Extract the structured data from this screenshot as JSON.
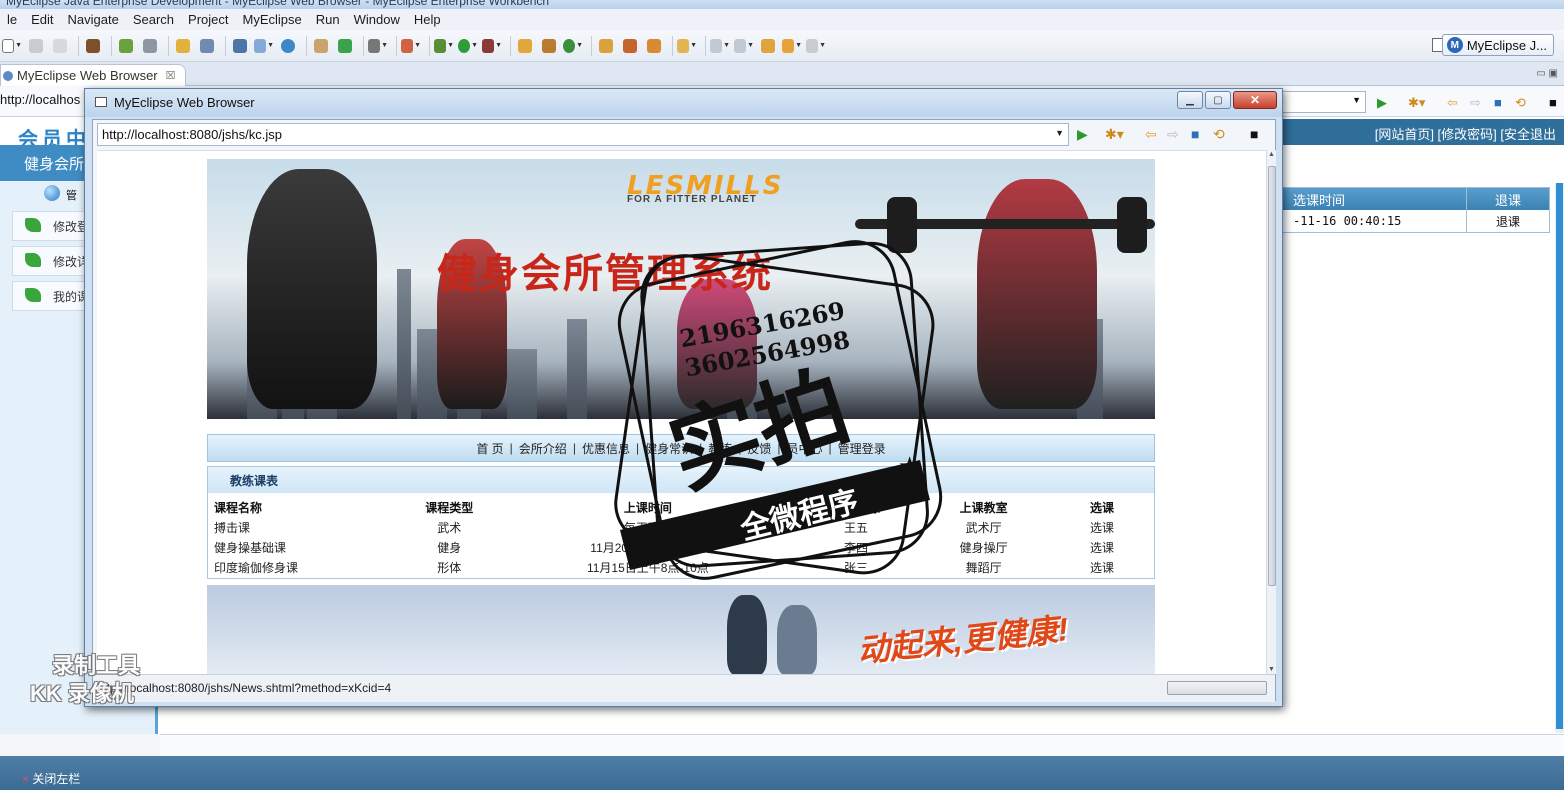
{
  "window": {
    "title": "MyEclipse Java Enterprise Development - MyEclipse Web Browser - MyEclipse Enterprise Workbench"
  },
  "menu": [
    "le",
    "Edit",
    "Navigate",
    "Search",
    "Project",
    "MyEclipse",
    "Run",
    "Window",
    "Help"
  ],
  "perspective": {
    "label": "MyEclipse J..."
  },
  "editor_tab": {
    "label": "MyEclipse Web Browser"
  },
  "bg_browser": {
    "url": "http://localhos"
  },
  "bg_page": {
    "logo": "会员中",
    "top_links": "[网站首页] [修改密码] [安全退出",
    "sidebar_title": "健身会所",
    "sidebar_items": [
      "管",
      "修改登",
      "修改详",
      "我的课"
    ],
    "table_headers": [
      "选课时间",
      "退课"
    ],
    "table_row": [
      "-11-16 00:40:15",
      "退课"
    ],
    "close_left": "关闭左栏"
  },
  "popup": {
    "title": "MyEclipse Web Browser",
    "url": "http://localhost:8080/jshs/kc.jsp",
    "status": "http://localhost:8080/jshs/News.shtml?method=xKcid=4"
  },
  "site": {
    "brand": "LESMILLS",
    "brand_sub": "FOR A FITTER PLANET",
    "title": "健身会所管理系统",
    "nav": [
      "首 页",
      "会所介绍",
      "优惠信息",
      "健身常识",
      "教练",
      "反馈",
      "员中心",
      "管理登录"
    ],
    "section_title": "教练课表",
    "columns": [
      "课程名称",
      "课程类型",
      "上课时间",
      "上课教练",
      "上课教室",
      "选课"
    ],
    "rows": [
      [
        "搏击课",
        "武术",
        "每天下午",
        "王五",
        "武术厅",
        "选课"
      ],
      [
        "健身操基础课",
        "健身",
        "11月20日下午2点-4点",
        "李四",
        "健身操厅",
        "选课"
      ],
      [
        "印度瑜伽修身课",
        "形体",
        "11月15日上午8点-10点",
        "张三",
        "舞蹈厅",
        "选课"
      ]
    ],
    "slogan": "动起来,更健康!"
  },
  "watermark": {
    "phone1": "2196316269",
    "phone2": "3602564998",
    "big": "实拍",
    "ribbon": "全微程序",
    "recorder_line1": "录制工具",
    "recorder_line2": "KK 录像机"
  }
}
